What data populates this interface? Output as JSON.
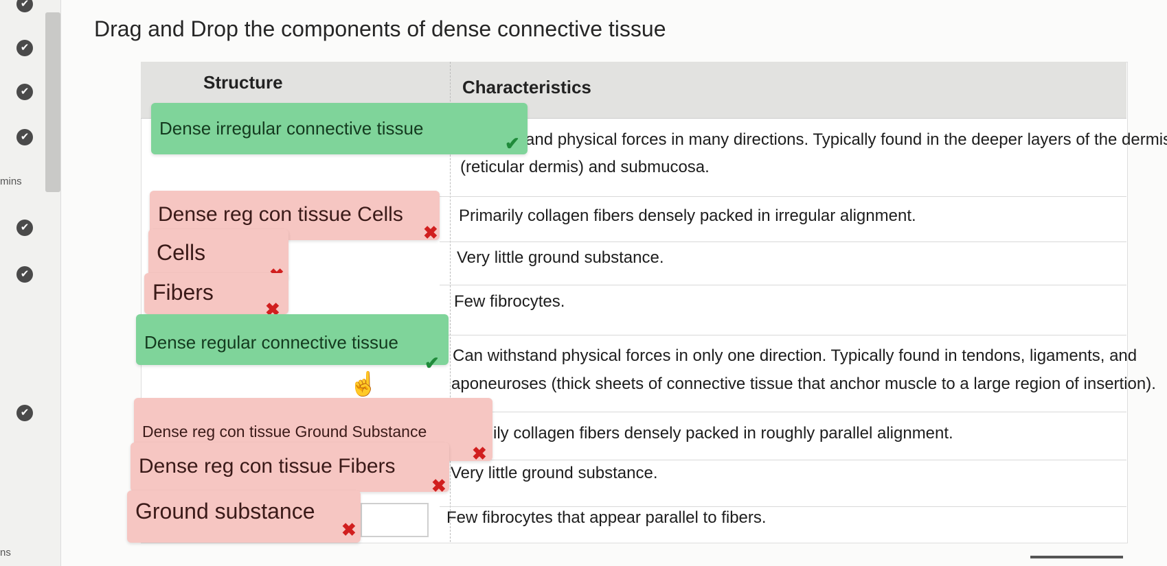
{
  "sidebar": {
    "time_label": "mins",
    "bottom_label": "ns",
    "check_glyph": "✔"
  },
  "title": "Drag and Drop the components of dense connective tissue",
  "table": {
    "headers": [
      "Structure",
      "Characteristics"
    ],
    "cells": [
      "and physical forces in many directions. Typically found in the deeper layers of the dermis",
      "(reticular dermis) and submucosa.",
      "Primarily collagen fibers densely packed in irregular alignment.",
      "Very little ground substance.",
      "Few fibrocytes.",
      "Can withstand physical forces in only one direction. Typically found in tendons, ligaments, and",
      "aponeuroses (thick sheets of connective tissue that anchor muscle to a large region of insertion).",
      "ily collagen fibers densely packed in roughly parallel alignment.",
      "Very little ground substance.",
      "Few fibrocytes that appear parallel to fibers."
    ]
  },
  "chips": [
    {
      "label": "Dense irregular connective tissue",
      "status": "correct"
    },
    {
      "label": "Dense reg con tissue Cells",
      "status": "incorrect"
    },
    {
      "label": "Cells",
      "status": "incorrect"
    },
    {
      "label": "Fibers",
      "status": "incorrect"
    },
    {
      "label": "Dense regular connective tissue",
      "status": "correct"
    },
    {
      "label": "Dense reg con tissue Ground Substance",
      "status": "incorrect"
    },
    {
      "label": "Dense reg con tissue Fibers",
      "status": "incorrect"
    },
    {
      "label": "Ground substance",
      "status": "incorrect"
    }
  ],
  "marks": {
    "tick": "✔",
    "x": "✖"
  },
  "colors": {
    "correct": "#7fd49a",
    "incorrect": "#f6c6c2",
    "tick": "#1f8a3a",
    "x": "#d11f1f"
  },
  "icons": {
    "cursor": "hand-pointer-icon"
  }
}
